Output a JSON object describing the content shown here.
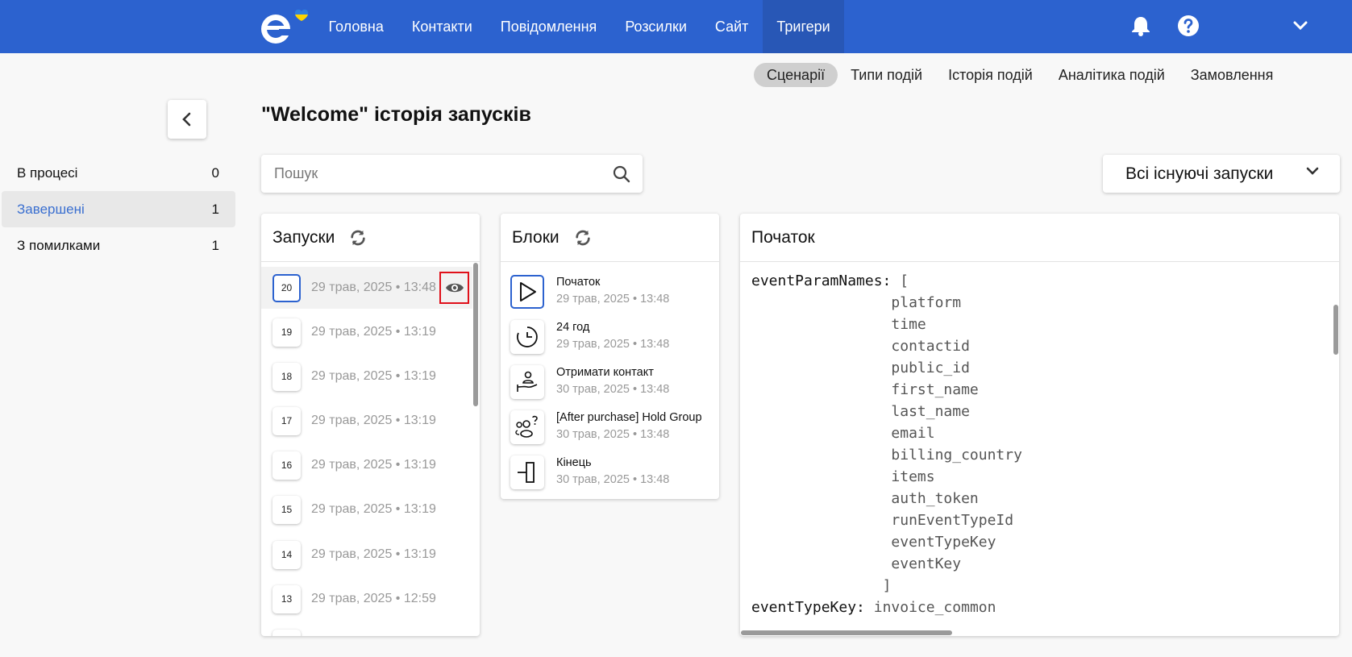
{
  "nav": {
    "items": [
      {
        "label": "Головна"
      },
      {
        "label": "Контакти"
      },
      {
        "label": "Повідомлення"
      },
      {
        "label": "Розсилки"
      },
      {
        "label": "Сайт"
      },
      {
        "label": "Тригери"
      }
    ],
    "active": "Тригери",
    "icons": [
      "bell-icon",
      "help-icon",
      "chevron-down-icon"
    ]
  },
  "subnav": {
    "items": [
      {
        "label": "Сценарії"
      },
      {
        "label": "Типи подій"
      },
      {
        "label": "Історія подій"
      },
      {
        "label": "Аналітика подій"
      },
      {
        "label": "Замовлення"
      }
    ],
    "active": "Сценарії"
  },
  "sidebar": {
    "items": [
      {
        "label": "В процесі",
        "count": "0"
      },
      {
        "label": "Завершені",
        "count": "1"
      },
      {
        "label": "З помилками",
        "count": "1"
      }
    ],
    "active": "Завершені"
  },
  "page": {
    "title": "\"Welcome\" історія запусків"
  },
  "search": {
    "placeholder": "Пошук"
  },
  "filter": {
    "label": "Всі існуючі запуски"
  },
  "runs": {
    "title": "Запуски",
    "items": [
      {
        "num": "20",
        "date": "29 трав, 2025 • 13:48"
      },
      {
        "num": "19",
        "date": "29 трав, 2025 • 13:19"
      },
      {
        "num": "18",
        "date": "29 трав, 2025 • 13:19"
      },
      {
        "num": "17",
        "date": "29 трав, 2025 • 13:19"
      },
      {
        "num": "16",
        "date": "29 трав, 2025 • 13:19"
      },
      {
        "num": "15",
        "date": "29 трав, 2025 • 13:19"
      },
      {
        "num": "14",
        "date": "29 трав, 2025 • 13:19"
      },
      {
        "num": "13",
        "date": "29 трав, 2025 • 12:59"
      }
    ]
  },
  "blocks": {
    "title": "Блоки",
    "items": [
      {
        "name": "Початок",
        "date": "29 трав, 2025 • 13:48",
        "icon": "play-icon"
      },
      {
        "name": "24 год",
        "date": "29 трав, 2025 • 13:48",
        "icon": "clock-icon"
      },
      {
        "name": "Отримати контакт",
        "date": "30 трав, 2025 • 13:48",
        "icon": "hand-user-icon"
      },
      {
        "name": "[After purchase] Hold Group",
        "date": "30 трав, 2025 • 13:48",
        "icon": "group-question-icon"
      },
      {
        "name": "Кінець",
        "date": "30 трав, 2025 • 13:48",
        "icon": "end-icon"
      }
    ]
  },
  "detail": {
    "title": "Початок",
    "param_key": "eventParamNames:",
    "open_bracket": "[",
    "params": [
      "platform",
      "time",
      "contactid",
      "public_id",
      "first_name",
      "last_name",
      "email",
      "billing_country",
      "items",
      "auth_token",
      "runEventTypeId",
      "eventTypeKey",
      "eventKey"
    ],
    "close_bracket": "]",
    "type_key": "eventTypeKey:",
    "type_value": "invoice_common"
  },
  "colors": {
    "brand": "#2c62cf",
    "highlight": "#e0101a",
    "logo_heart_blue": "#2f7fe0",
    "logo_heart_yellow": "#ffd500"
  }
}
